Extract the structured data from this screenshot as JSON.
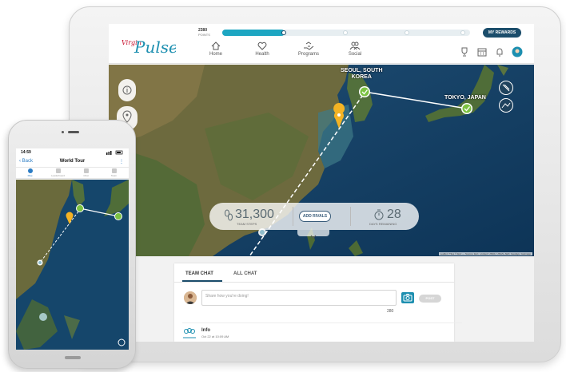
{
  "tablet": {
    "brand": {
      "logo_text": "Pulse",
      "logo_prefix": "Virgin"
    },
    "points": {
      "value": "2380",
      "label": "POINTS"
    },
    "progress": {
      "fraction": 0.25
    },
    "rewards_button": "MY REWARDS",
    "nav": [
      {
        "label": "Home",
        "icon": "home-icon"
      },
      {
        "label": "Health",
        "icon": "heart-icon"
      },
      {
        "label": "Programs",
        "icon": "programs-icon"
      },
      {
        "label": "Social",
        "icon": "social-icon"
      }
    ],
    "map": {
      "city_labels": [
        {
          "line1": "SEOUL, SOUTH",
          "line2": "KOREA"
        },
        {
          "line1": "TOKYO, JAPAN",
          "line2": ""
        }
      ],
      "stats": {
        "steps_value": "31,300",
        "steps_label": "TEAM STEPS",
        "rivals_button": "ADD RIVALS",
        "days_value": "28",
        "days_label": "DAYS REMAINING"
      },
      "attribution": "Leaflet | Tiles © Esri — Source: Esri, i-cubed, USDA, USGS, AEX, GeoEye, Getmapp"
    },
    "chat": {
      "tabs": [
        "TEAM CHAT",
        "ALL CHAT"
      ],
      "placeholder": "Share how you're doing!",
      "char_count": "280",
      "post_button": "POST",
      "info_title": "Info",
      "info_date": "Oct 22 at 10:09 AM"
    }
  },
  "phone": {
    "time": "14:59",
    "back": "Back",
    "title": "World Tour",
    "tabs": [
      "Map",
      "Leaderboard",
      "Chat",
      "Team"
    ]
  },
  "colors": {
    "accent": "#1da6c2",
    "brand_dark": "#1b4d6b",
    "logo_red": "#c8102e",
    "checkpoint_green": "#7cc242",
    "pin_yellow": "#f4b324"
  }
}
